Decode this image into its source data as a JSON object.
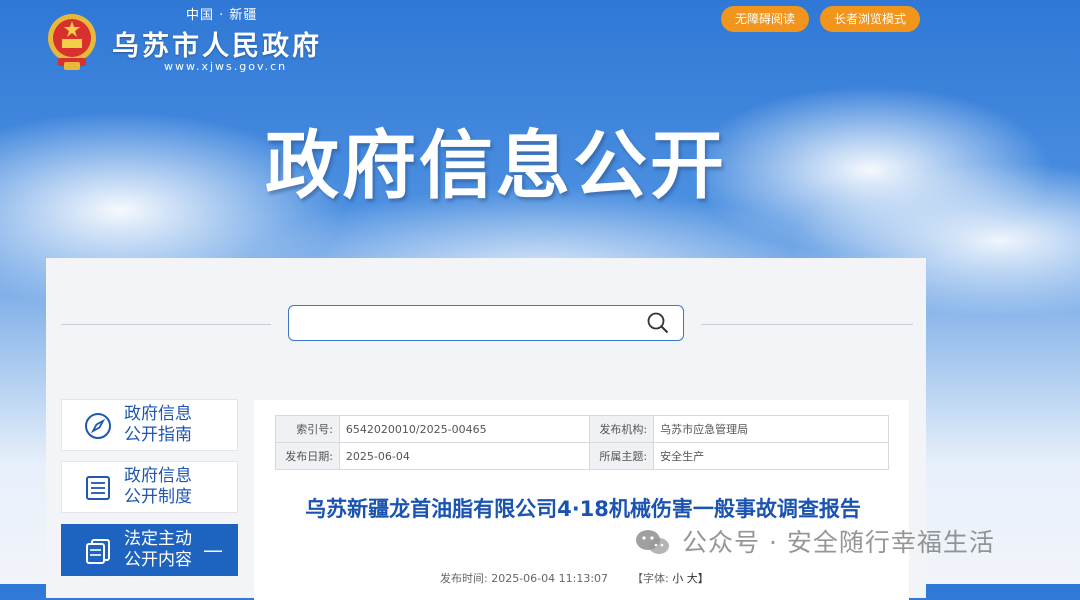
{
  "header": {
    "top_text": "中国 · 新疆",
    "site_name": "乌苏市人民政府",
    "url": "www.xjws.gov.cn",
    "buttons": [
      "无障碍阅读",
      "长者浏览模式"
    ]
  },
  "hero": {
    "title": "政府信息公开"
  },
  "search": {
    "placeholder": ""
  },
  "sidebar": {
    "items": [
      {
        "label_line1": "政府信息",
        "label_line2": "公开指南",
        "icon": "compass-icon",
        "active": false
      },
      {
        "label_line1": "政府信息",
        "label_line2": "公开制度",
        "icon": "document-list-icon",
        "active": false
      },
      {
        "label_line1": "法定主动",
        "label_line2": "公开内容",
        "icon": "copy-pages-icon",
        "active": true,
        "toggle": "—"
      }
    ]
  },
  "article": {
    "meta": {
      "index_label": "索引号:",
      "index_value": "6542020010/2025-00465",
      "org_label": "发布机构:",
      "org_value": "乌苏市应急管理局",
      "date_label": "发布日期:",
      "date_value": "2025-06-04",
      "topic_label": "所属主题:",
      "topic_value": "安全生产"
    },
    "title": "乌苏新疆龙首油脂有限公司4·18机械伤害一般事故调查报告",
    "publish_time": "发布时间:  2025-06-04 11:13:07",
    "font_label": "【字体:",
    "font_small": "小",
    "font_large": "大】"
  },
  "watermark": {
    "text": "公众号 · 安全随行幸福生活"
  },
  "colors": {
    "orange": "#f2951d",
    "blue": "#1f63c1",
    "title_blue": "#1a53b0"
  }
}
